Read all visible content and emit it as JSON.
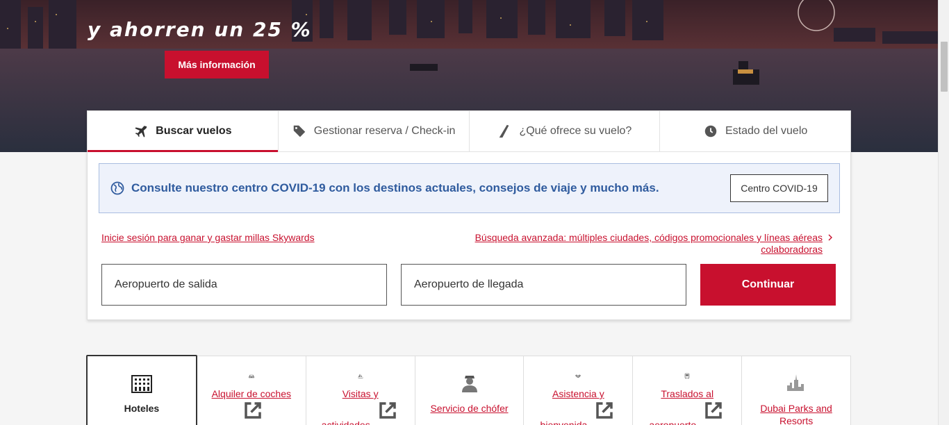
{
  "hero": {
    "headline": "y ahorren un 25 %",
    "cta_label": "Más información"
  },
  "tabs": [
    {
      "label": "Buscar vuelos",
      "icon": "plane-icon",
      "active": true
    },
    {
      "label": "Gestionar reserva / Check-in",
      "icon": "tag-icon",
      "active": false
    },
    {
      "label": "¿Qué ofrece su vuelo?",
      "icon": "seat-icon",
      "active": false
    },
    {
      "label": "Estado del vuelo",
      "icon": "clock-icon",
      "active": false
    }
  ],
  "covid": {
    "message": "Consulte nuestro centro COVID-19 con los destinos actuales, consejos de viaje y mucho más.",
    "button_label": "Centro COVID-19"
  },
  "links": {
    "login": "Inicie sesión para ganar y gastar millas Skywards",
    "advanced_line1": "Búsqueda avanzada: múltiples ciudades, códigos promocionales y líneas aéreas",
    "advanced_line2": "colaboradoras"
  },
  "search": {
    "departure_placeholder": "Aeropuerto de salida",
    "arrival_placeholder": "Aeropuerto de llegada",
    "continue_label": "Continuar"
  },
  "services": [
    {
      "label": "Hoteles",
      "icon": "hotel-icon",
      "active": true,
      "external": false
    },
    {
      "label": "Alquiler de coches",
      "icon": "car-icon",
      "active": false,
      "external": true
    },
    {
      "label": "Visitas y actividades",
      "icon": "sailboat-icon",
      "active": false,
      "external": true
    },
    {
      "label": "Servicio de chófer",
      "icon": "chauffeur-icon",
      "active": false,
      "external": false
    },
    {
      "label": "Asistencia y bienvenida",
      "icon": "handshake-icon",
      "active": false,
      "external": true
    },
    {
      "label": "Traslados al aeropuerto",
      "icon": "bus-icon",
      "active": false,
      "external": true
    },
    {
      "label": "Dubai Parks and Resorts",
      "icon": "skyline-icon",
      "active": false,
      "external": false
    }
  ],
  "colors": {
    "brand_red": "#c8102e",
    "covid_blue": "#2f5b9e"
  }
}
